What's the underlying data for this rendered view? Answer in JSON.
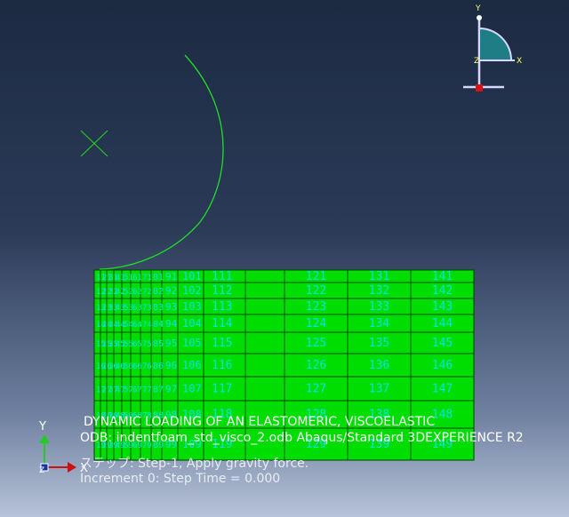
{
  "viewport": {
    "background_top": "#1c2a42",
    "background_bottom": "#b7c3d8",
    "mesh_fill_color": "#00dd00",
    "mesh_edge_color": "#004400",
    "node_label_color": "#00e5e5",
    "indenter_color": "#22dd22"
  },
  "mesh": {
    "columns": [
      {
        "left_labels": [
          "11",
          "12",
          "13",
          "14",
          "15",
          "16",
          "17",
          "18",
          "19"
        ]
      },
      {
        "left_labels": [
          "21",
          "22",
          "23",
          "24",
          "25",
          "26",
          "27",
          "28",
          "29"
        ]
      },
      {
        "left_labels": [
          "31",
          "32",
          "33",
          "34",
          "35",
          "36",
          "37",
          "38",
          "39"
        ]
      },
      {
        "left_labels": [
          "41",
          "42",
          "43",
          "44",
          "45",
          "46",
          "47",
          "48",
          "49"
        ]
      },
      {
        "left_labels": [
          "51",
          "52",
          "53",
          "54",
          "55",
          "56",
          "57",
          "58",
          "59"
        ]
      },
      {
        "left_labels": [
          "61",
          "62",
          "63",
          "64",
          "65",
          "66",
          "67",
          "68",
          "69"
        ]
      },
      {
        "left_labels": [
          "71",
          "72",
          "73",
          "74",
          "75",
          "76",
          "77",
          "78",
          "79"
        ]
      },
      {
        "left_labels": [
          "81",
          "82",
          "83",
          "84",
          "85",
          "86",
          "87",
          "88",
          "89"
        ]
      },
      {
        "left_labels": [
          "91",
          "92",
          "93",
          "94",
          "95",
          "96",
          "97",
          "98",
          "99"
        ]
      },
      {
        "left_labels": [
          "101",
          "102",
          "103",
          "104",
          "105",
          "106",
          "107",
          "108",
          "109"
        ]
      },
      {
        "left_labels": [
          "111",
          "112",
          "113",
          "114",
          "115",
          "116",
          "117",
          "118",
          "119"
        ]
      },
      {
        "left_labels": [
          "121",
          "122",
          "123",
          "124",
          "125",
          "126",
          "127",
          "128",
          "129"
        ]
      },
      {
        "left_labels": [
          "131",
          "132",
          "133",
          "134",
          "135",
          "136",
          "137",
          "138",
          "139"
        ]
      },
      {
        "left_labels": [
          "141",
          "142",
          "143",
          "144",
          "145",
          "146",
          "147",
          "148",
          "149"
        ]
      }
    ]
  },
  "triad": {
    "x_label": "X",
    "y_label": "Y",
    "z_label": "Z"
  },
  "view_triad": {
    "x_label": "X",
    "y_label": "Y",
    "z_label": "Z"
  },
  "info": {
    "title": "DYNAMIC LOADING OF AN ELASTOMERIC, VISCOELASTIC",
    "odb": "ODB: indentfoam_std_visco_2.odb    Abaqus/Standard 3DEXPERIENCE R2",
    "step": "ステップ: Step-1,  Apply gravity force.",
    "increment": "Increment      0: Step Time =    0.000"
  }
}
